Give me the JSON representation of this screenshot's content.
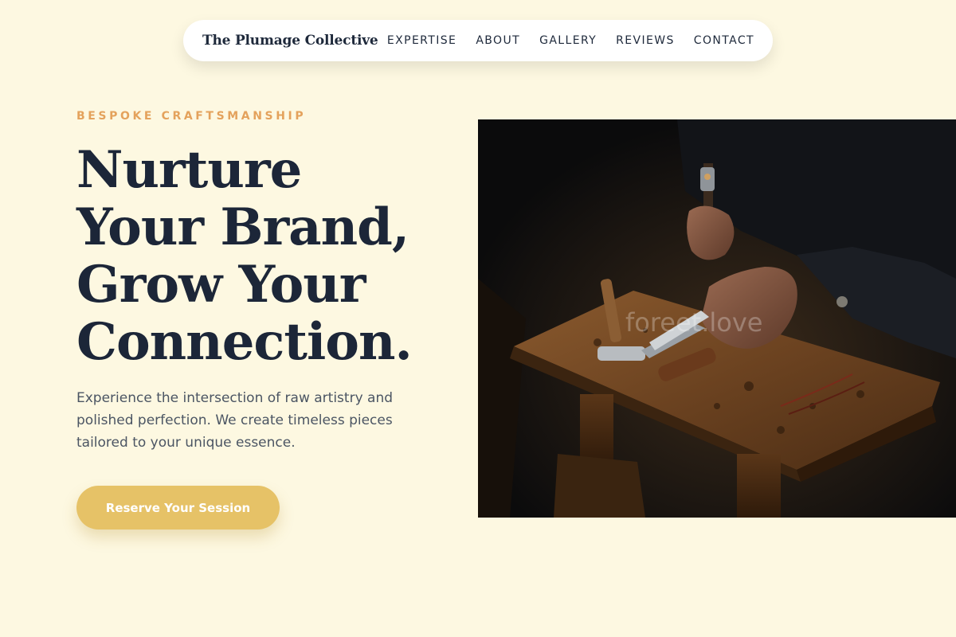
{
  "nav": {
    "brand": "The Plumage Collective",
    "links": [
      "EXPERTISE",
      "ABOUT",
      "GALLERY",
      "REVIEWS",
      "CONTACT"
    ]
  },
  "hero": {
    "eyebrow": "BESPOKE CRAFTSMANSHIP",
    "headline_lines": [
      "Nurture",
      "Your Brand,",
      "Grow Your",
      "Connection."
    ],
    "lede": "Experience the intersection of raw artistry and polished perfection. We create timeless pieces tailored to your unique essence.",
    "cta_label": "Reserve Your Session",
    "image_watermark": "foreet.love"
  },
  "colors": {
    "background": "#fdf8e1",
    "accent_gold": "#e6c267",
    "eyebrow_orange": "#e4a25c",
    "heading_navy": "#1c2638"
  },
  "icons": {
    "hero_image": "craftsman-workbench-photo"
  }
}
